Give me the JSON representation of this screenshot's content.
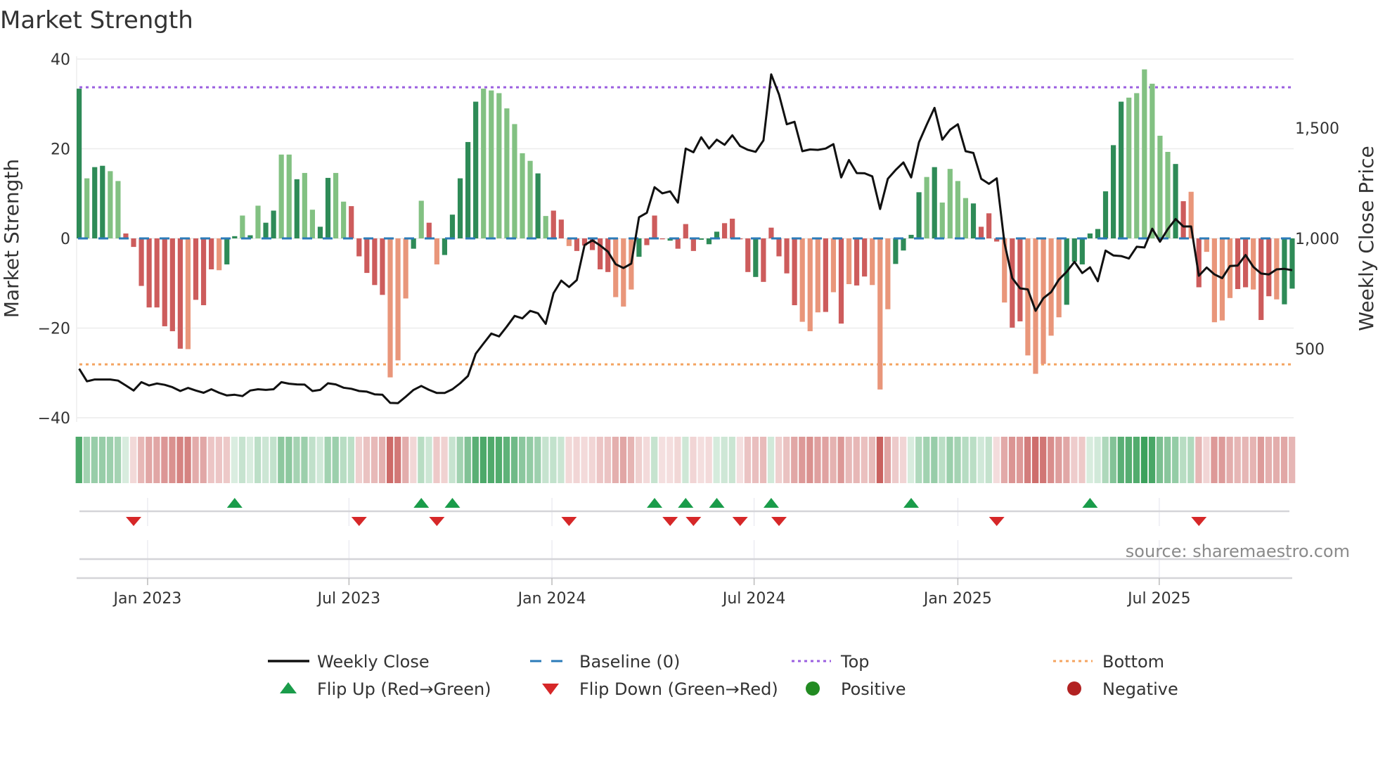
{
  "chart_data": {
    "type": "bar",
    "title": "Market Strength",
    "ylabel": "Market Strength",
    "y2label": "Weekly Close Price",
    "ylim": [
      -40,
      40
    ],
    "y2lim": [
      200,
      1800
    ],
    "yticks": [
      "40",
      "20",
      "0",
      "−20",
      "−40"
    ],
    "ytick_values": [
      40,
      20,
      0,
      -20,
      -40
    ],
    "y2ticks": [
      "1,500",
      "1,000",
      "500"
    ],
    "y2tick_values": [
      1500,
      1000,
      500
    ],
    "xticks": [
      "Jan 2023",
      "Jul 2023",
      "Jan 2024",
      "Jul 2024",
      "Jan 2025",
      "Jul 2025"
    ],
    "xtick_weeks": [
      8.8,
      34.7,
      60.8,
      86.8,
      113.0,
      138.9
    ],
    "grid": true,
    "top_level": 33.7,
    "bottom_level": -28.1,
    "baseline": 0,
    "strength": [
      33.4,
      13.4,
      15.9,
      16.2,
      15.0,
      12.8,
      1.1,
      -1.9,
      -10.6,
      -15.4,
      -15.4,
      -19.6,
      -20.7,
      -24.6,
      -24.7,
      -13.7,
      -14.9,
      -6.9,
      -7.1,
      -5.8,
      0.5,
      5.1,
      0.7,
      7.3,
      3.5,
      6.2,
      18.7,
      18.7,
      13.2,
      14.6,
      6.4,
      2.6,
      13.5,
      14.6,
      8.2,
      7.2,
      -4.0,
      -7.7,
      -10.4,
      -12.6,
      -31.0,
      -27.2,
      -13.4,
      -2.3,
      8.4,
      3.5,
      -5.8,
      -3.7,
      5.3,
      13.4,
      21.5,
      30.5,
      33.4,
      33.0,
      32.4,
      29.0,
      25.5,
      19.0,
      17.3,
      14.5,
      5.0,
      6.2,
      4.2,
      -1.7,
      -2.8,
      -1.6,
      -2.6,
      -6.9,
      -7.5,
      -13.1,
      -15.2,
      -11.4,
      -4.1,
      -1.5,
      5.1,
      -0.2,
      -0.5,
      -2.3,
      3.2,
      -2.8,
      -0.3,
      -1.3,
      1.5,
      3.4,
      4.4,
      -0.2,
      -7.5,
      -8.6,
      -9.7,
      2.4,
      -4.0,
      -7.8,
      -14.9,
      -18.6,
      -20.7,
      -16.5,
      -16.4,
      -12.0,
      -19.0,
      -10.2,
      -10.5,
      -8.5,
      -10.4,
      -33.7,
      -15.8,
      -5.7,
      -2.7,
      0.8,
      10.3,
      13.7,
      15.9,
      8.0,
      15.5,
      12.8,
      9.0,
      7.8,
      2.6,
      5.6,
      -0.7,
      -14.3,
      -19.9,
      -18.5,
      -26.1,
      -30.2,
      -28.0,
      -21.7,
      -17.6,
      -14.8,
      -5.2,
      -5.8,
      1.1,
      2.1,
      10.5,
      20.8,
      30.5,
      31.4,
      32.4,
      37.7,
      34.5,
      22.9,
      19.3,
      16.6,
      8.3,
      10.4,
      -10.9,
      -3.0,
      -18.7,
      -18.3,
      -13.3,
      -11.3,
      -10.9,
      -11.4,
      -18.2,
      -12.9,
      -13.6,
      -14.7,
      -11.2
    ],
    "tone": "GgGGggRRRRRRRRrRRRrGGgGgGGggGggGGggRRRRRrrrGgRrGGGGGgggggggGgRRrRRRRRrrrGRRRGRRRGGGRRRRGRRRRRrrrRrRrRRrrrGGGGgGggggGRRRrRRrrrrrGGGGGGGGggggggGRrRrrrrRRrRRr",
    "weekly_close": [
      410,
      353,
      361,
      361,
      361,
      356,
      334,
      311,
      349,
      334,
      343,
      337,
      326,
      309,
      323,
      311,
      301,
      317,
      301,
      289,
      292,
      286,
      311,
      317,
      314,
      317,
      349,
      342,
      339,
      338,
      309,
      314,
      344,
      339,
      324,
      319,
      309,
      306,
      294,
      292,
      255,
      254,
      283,
      314,
      332,
      314,
      300,
      300,
      317,
      344,
      377,
      478,
      524,
      569,
      556,
      601,
      649,
      638,
      672,
      661,
      613,
      752,
      809,
      780,
      811,
      970,
      991,
      968,
      940,
      883,
      866,
      886,
      1096,
      1116,
      1232,
      1204,
      1213,
      1162,
      1407,
      1390,
      1458,
      1407,
      1447,
      1424,
      1467,
      1418,
      1401,
      1392,
      1444,
      1743,
      1652,
      1517,
      1528,
      1395,
      1403,
      1401,
      1407,
      1427,
      1276,
      1355,
      1296,
      1295,
      1281,
      1133,
      1270,
      1310,
      1344,
      1276,
      1435,
      1515,
      1591,
      1447,
      1492,
      1517,
      1395,
      1387,
      1270,
      1247,
      1272,
      979,
      820,
      774,
      769,
      672,
      729,
      757,
      814,
      849,
      894,
      843,
      869,
      806,
      945,
      923,
      920,
      909,
      962,
      959,
      1044,
      985,
      1042,
      1088,
      1054,
      1054,
      831,
      868,
      837,
      820,
      875,
      877,
      925,
      871,
      841,
      837,
      860,
      862,
      856
    ],
    "flip_up_weeks": [
      20,
      44,
      48,
      74,
      78,
      82,
      89,
      107,
      130
    ],
    "flip_down_weeks": [
      7,
      36,
      46,
      63,
      76,
      79,
      85,
      90,
      118,
      144
    ],
    "legend": {
      "placement": "bottom",
      "items": [
        {
          "label": "Weekly Close",
          "kind": "line"
        },
        {
          "label": "Baseline (0)",
          "kind": "dash"
        },
        {
          "label": "Top",
          "kind": "dot-purple"
        },
        {
          "label": "Bottom",
          "kind": "dot-orange"
        },
        {
          "label": "Flip Up (Red→Green)",
          "kind": "tri-up"
        },
        {
          "label": "Flip Down (Green→Red)",
          "kind": "tri-down"
        },
        {
          "label": "Positive",
          "kind": "circle-green"
        },
        {
          "label": "Negative",
          "kind": "circle-red"
        }
      ]
    },
    "annotation": "source: sharemaestro.com",
    "colors": {
      "rising_positive": "#2e8b57",
      "falling_positive": "#82c182",
      "falling_negative": "#cd5c5c",
      "rising_negative": "#e9967a",
      "close_line": "#111111",
      "baseline": "#2b7bb9",
      "top": "#9b5fe0",
      "bottom": "#f4a460",
      "flip_up": "#1a9c4a",
      "flip_down": "#d62728",
      "positive": "#228b22",
      "negative": "#b22222"
    }
  }
}
